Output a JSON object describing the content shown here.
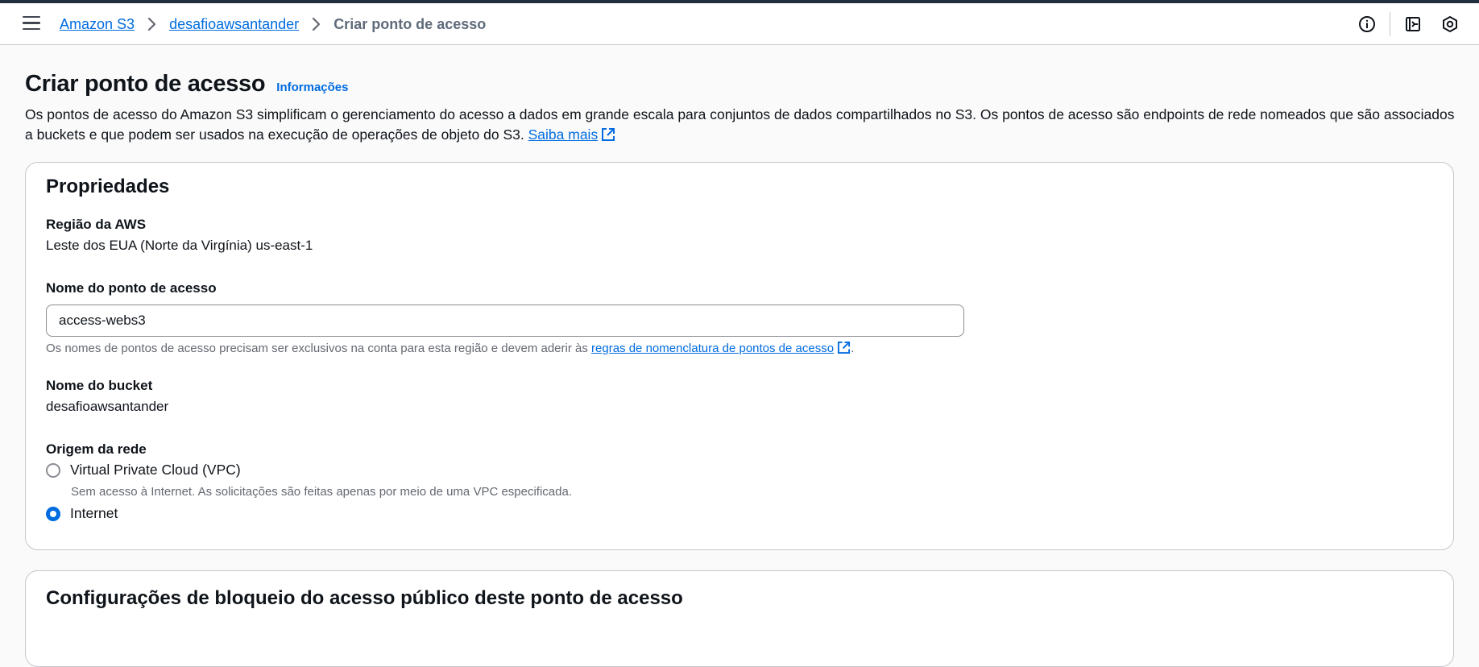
{
  "breadcrumb": {
    "items": [
      "Amazon S3",
      "desafioawsantander"
    ],
    "current": "Criar ponto de acesso"
  },
  "page": {
    "title": "Criar ponto de acesso",
    "info_link": "Informações",
    "description": "Os pontos de acesso do Amazon S3 simplificam o gerenciamento do acesso a dados em grande escala para conjuntos de dados compartilhados no S3. Os pontos de acesso são endpoints de rede nomeados que são associados a buckets e que podem ser usados na execução de operações de objeto do S3.",
    "learn_more": "Saiba mais"
  },
  "properties": {
    "heading": "Propriedades",
    "region_label": "Região da AWS",
    "region_value": "Leste dos EUA (Norte da Virgínia) us-east-1",
    "name_label": "Nome do ponto de acesso",
    "name_value": "access-webs3",
    "name_hint": "Os nomes de pontos de acesso precisam ser exclusivos na conta para esta região e devem aderir às",
    "name_hint_link": "regras de nomenclatura de pontos de acesso",
    "name_hint_end": ".",
    "bucket_label": "Nome do bucket",
    "bucket_value": "desafioawsantander",
    "network_label": "Origem da rede",
    "network_options": [
      {
        "label": "Virtual Private Cloud (VPC)",
        "description": "Sem acesso à Internet. As solicitações são feitas apenas por meio de uma VPC especificada.",
        "selected": false
      },
      {
        "label": "Internet",
        "description": "",
        "selected": true
      }
    ]
  },
  "block_public": {
    "heading": "Configurações de bloqueio do acesso público deste ponto de acesso"
  },
  "icons": {
    "menu": "hamburger-menu-icon",
    "info": "info-circle-icon",
    "notifications": "notification-icon",
    "settings": "settings-hexagon-icon",
    "external": "external-link-icon"
  },
  "colors": {
    "link": "#006ce0",
    "text": "#0f141a",
    "muted": "#656871",
    "border": "#c6c6cd"
  }
}
